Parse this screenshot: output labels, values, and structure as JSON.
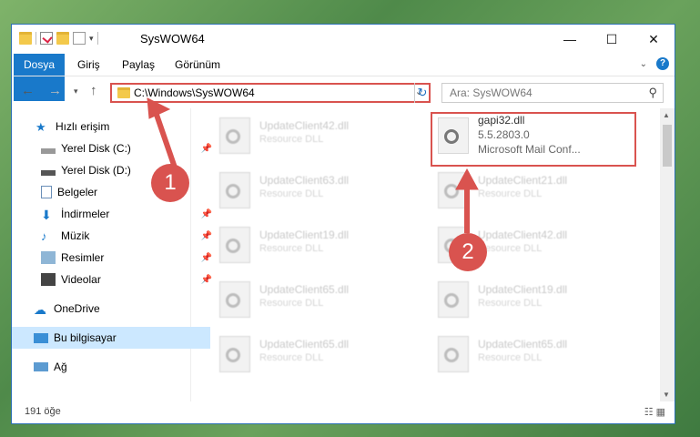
{
  "window": {
    "title": "SysWOW64"
  },
  "ribbon": {
    "tabs": [
      "Dosya",
      "Giriş",
      "Paylaş",
      "Görünüm"
    ]
  },
  "address": {
    "path": "C:\\Windows\\SysWOW64"
  },
  "search": {
    "placeholder": "Ara: SysWOW64"
  },
  "sidebar": {
    "items": [
      {
        "label": "Hızlı erişim"
      },
      {
        "label": "Yerel Disk (C:)"
      },
      {
        "label": "Yerel Disk (D:)"
      },
      {
        "label": "Belgeler"
      },
      {
        "label": "İndirmeler"
      },
      {
        "label": "Müzik"
      },
      {
        "label": "Resimler"
      },
      {
        "label": "Videolar"
      },
      {
        "label": "OneDrive"
      },
      {
        "label": "Bu bilgisayar"
      },
      {
        "label": "Ağ"
      }
    ]
  },
  "files": {
    "left": [
      {
        "name": "UpdateClient42.dll",
        "type": "Resource DLL"
      },
      {
        "name": "UpdateClient63.dll",
        "type": "Resource DLL"
      },
      {
        "name": "UpdateClient19.dll",
        "type": "Resource DLL"
      },
      {
        "name": "UpdateClient65.dll",
        "type": "Resource DLL"
      },
      {
        "name": "UpdateClient65.dll",
        "type": "Resource DLL"
      }
    ],
    "right": [
      {
        "name": "gapi32.dll",
        "version": "5.5.2803.0",
        "desc": "Microsoft Mail Conf..."
      },
      {
        "name": "UpdateClient21.dll",
        "type": "Resource DLL"
      },
      {
        "name": "UpdateClient42.dll",
        "type": "Resource DLL"
      },
      {
        "name": "UpdateClient19.dll",
        "type": "Resource DLL"
      },
      {
        "name": "UpdateClient65.dll",
        "type": "Resource DLL"
      }
    ]
  },
  "status": {
    "count": "191 öğe"
  },
  "annotations": {
    "one": "1",
    "two": "2"
  },
  "colors": {
    "accent": "#1979ca",
    "highlight": "#d9534f",
    "selected": "#cce8ff"
  }
}
